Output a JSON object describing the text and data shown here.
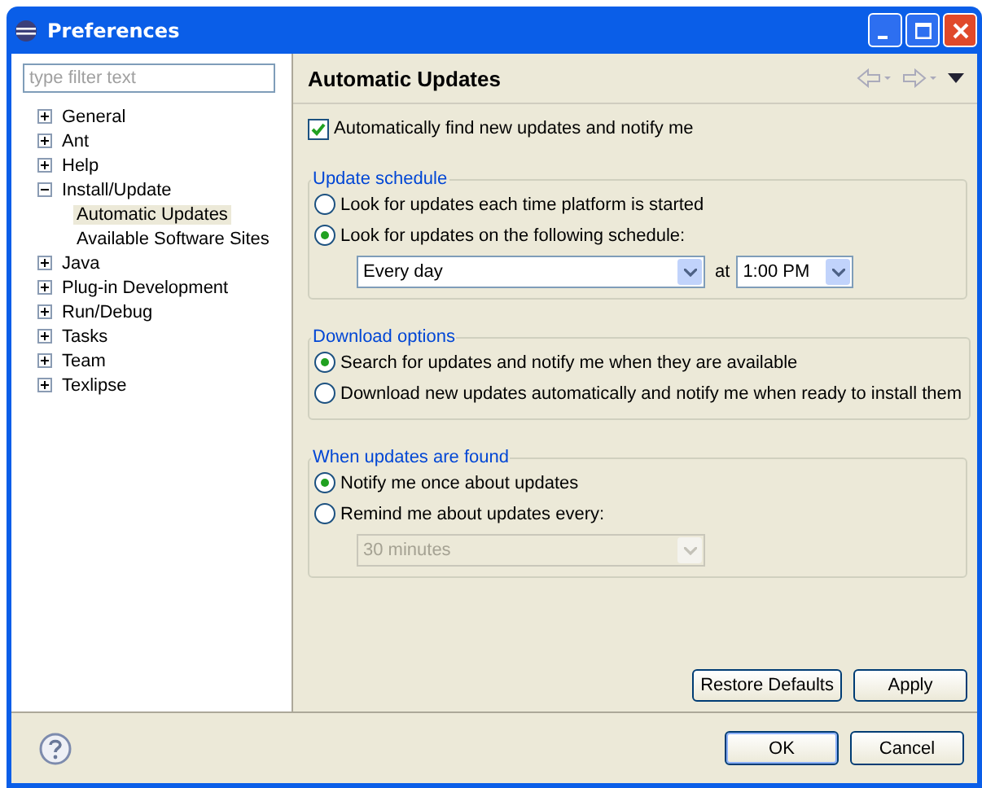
{
  "window": {
    "title": "Preferences"
  },
  "filter": {
    "placeholder": "type filter text"
  },
  "tree": [
    {
      "label": "General",
      "expanded": false,
      "selected": false
    },
    {
      "label": "Ant",
      "expanded": false,
      "selected": false
    },
    {
      "label": "Help",
      "expanded": false,
      "selected": false
    },
    {
      "label": "Install/Update",
      "expanded": true,
      "selected": false,
      "children": [
        {
          "label": "Automatic Updates",
          "selected": true
        },
        {
          "label": "Available Software Sites",
          "selected": false
        }
      ]
    },
    {
      "label": "Java",
      "expanded": false,
      "selected": false
    },
    {
      "label": "Plug-in Development",
      "expanded": false,
      "selected": false
    },
    {
      "label": "Run/Debug",
      "expanded": false,
      "selected": false
    },
    {
      "label": "Tasks",
      "expanded": false,
      "selected": false
    },
    {
      "label": "Team",
      "expanded": false,
      "selected": false
    },
    {
      "label": "Texlipse",
      "expanded": false,
      "selected": false
    }
  ],
  "page": {
    "title": "Automatic Updates",
    "auto_find": {
      "label": "Automatically find new updates and notify me",
      "checked": true
    },
    "groups": [
      {
        "title": "Update schedule",
        "options": [
          {
            "label": "Look for updates each time platform is started",
            "selected": false
          },
          {
            "label": "Look for updates on the following schedule:",
            "selected": true
          }
        ],
        "schedule": {
          "day": "Every day",
          "at": "at",
          "time": "1:00 PM",
          "disabled": false
        }
      },
      {
        "title": "Download options",
        "options": [
          {
            "label": "Search for updates and notify me when they are available",
            "selected": true
          },
          {
            "label": "Download new updates automatically and notify me when ready to install them",
            "selected": false
          }
        ]
      },
      {
        "title": "When updates are found",
        "options": [
          {
            "label": "Notify me once about updates",
            "selected": true
          },
          {
            "label": "Remind me about updates every:",
            "selected": false
          }
        ],
        "remind": {
          "value": "30 minutes",
          "disabled": true
        }
      }
    ],
    "buttons": [
      "Restore Defaults",
      "Apply"
    ]
  },
  "dialog_buttons": [
    "OK",
    "Cancel"
  ]
}
